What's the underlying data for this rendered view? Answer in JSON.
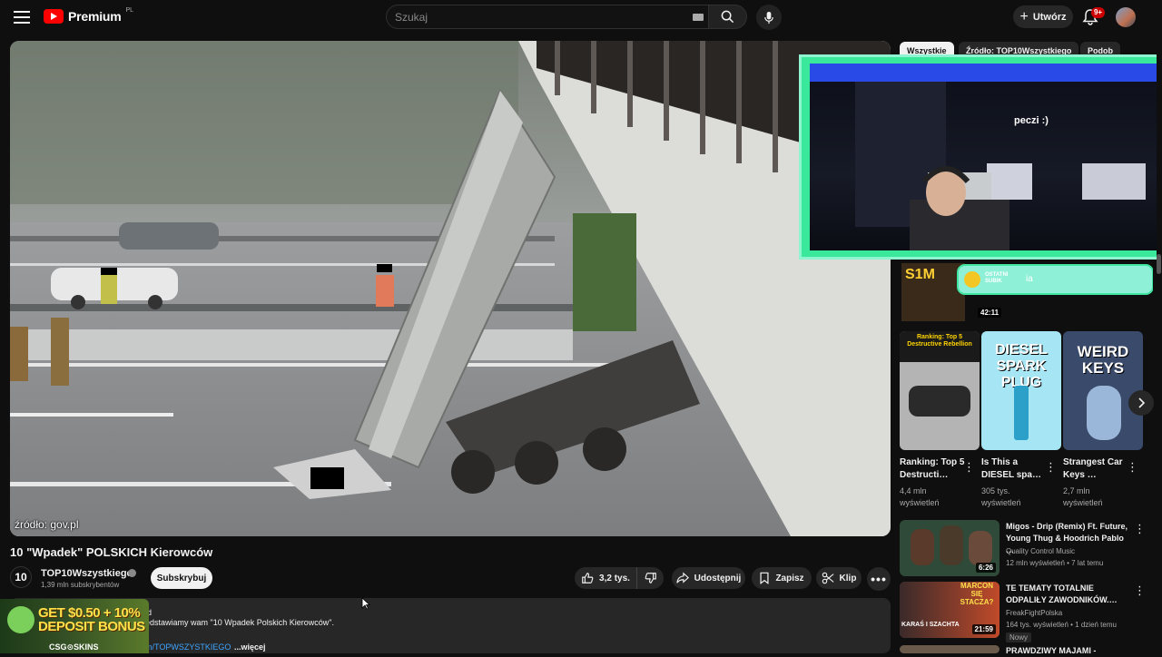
{
  "header": {
    "logo_text": "Premium",
    "logo_country": "PL",
    "search_placeholder": "Szukaj",
    "create_label": "Utwórz",
    "notif_badge": "9+"
  },
  "video": {
    "source_caption": "źródło: gov.pl",
    "title": "10 \"Wpadek\" POLSKICH Kierowców",
    "channel": "TOP10Wszystkiego",
    "channel_avatar_text": "10",
    "subscribers": "1,39 mln subskrybentów",
    "subscribe_label": "Subskrybuj",
    "likes": "3,2 tys.",
    "share_label": "Udostępnij",
    "save_label": "Zapisz",
    "clip_label": "Klip"
  },
  "description": {
    "line_d": "d",
    "line1": "edstawiamy wam \"10 Wpadek Polskich Kierowców\".",
    "link": "m/TOPWSZYSTKIEGO",
    "more": "...więcej"
  },
  "ad": {
    "line1": "GET $0.50 + 10%",
    "line2": "DEPOSIT BONUS",
    "brand": "CSG⊙SKINS"
  },
  "chips": [
    "Wszystkie",
    "Źródło: TOP10Wszystkiego",
    "Podob"
  ],
  "webcam": {
    "text": "peczi :)"
  },
  "overlay_banner": {
    "big": "S1M",
    "sub": "OSTATNI SUBIK",
    "tag": "ia",
    "duration": "42:11"
  },
  "shorts": [
    {
      "thumb_text": "Ranking: Top 5 Destructive Rebellion",
      "title": "Ranking: Top 5 Destructi…",
      "views1": "4,4 mln",
      "views2": "wyświetleń"
    },
    {
      "thumb_text": "DIESEL SPARK PLUG",
      "title": "Is This a DIESEL spa…",
      "views1": "305 tys.",
      "views2": "wyświetleń"
    },
    {
      "thumb_text": "WEIRD KEYS",
      "title": "Strangest Car Keys …",
      "views1": "2,7 mln",
      "views2": "wyświetleń"
    }
  ],
  "recommended": [
    {
      "title": "Migos - Drip (Remix) Ft. Future, Young Thug & Hoodrich Pablo …",
      "channel": "Quality Control Music",
      "meta": "12 mln wyświetleń • 7 lat temu",
      "duration": "6:26"
    },
    {
      "title": "TE TEMATY TOTALNIE ODPALIŁY ZAWODNIKÓW.…",
      "channel": "FreakFightPolska",
      "meta": "164 tys. wyświetleń • 1 dzień temu",
      "badge": "Nowy",
      "duration": "21:59",
      "thumb_text1": "MARCON SIĘ STACZA?",
      "thumb_text2": "KARAŚ I SZACHTA"
    },
    {
      "title": "PRAWDZIWY MAJAMI -"
    }
  ]
}
